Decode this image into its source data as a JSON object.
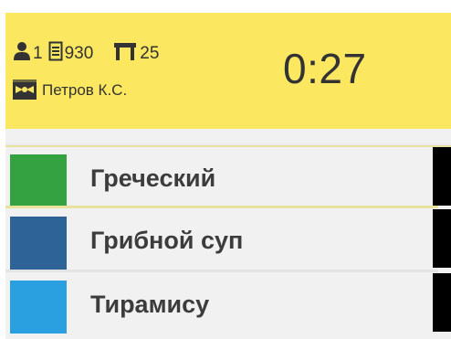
{
  "header": {
    "guests": "1",
    "order_number": "930",
    "table_number": "25",
    "waiter": "Петров К.С.",
    "timer": "0:27",
    "icons": {
      "guest": "person-icon",
      "order": "receipt-icon",
      "table": "table-icon",
      "waiter": "waiter-bowtie-icon"
    },
    "colors": {
      "background": "#fbe760"
    }
  },
  "items": [
    {
      "name": "Греческий",
      "color": "#35a241"
    },
    {
      "name": "Грибной суп",
      "color": "#2e6398"
    },
    {
      "name": "Тирамису",
      "color": "#2aa0e0"
    }
  ]
}
